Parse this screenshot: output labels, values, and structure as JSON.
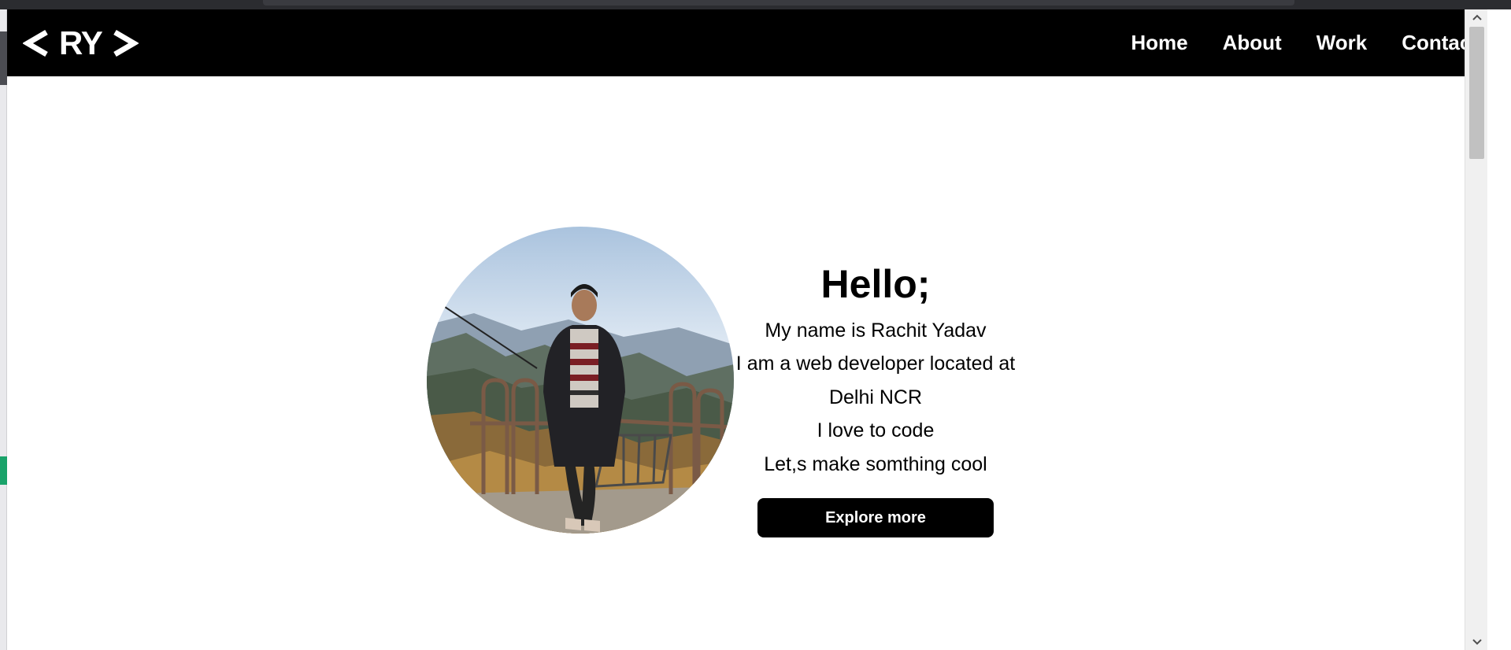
{
  "navbar": {
    "logo_text": "RY",
    "links": [
      {
        "label": "Home"
      },
      {
        "label": "About"
      },
      {
        "label": "Work"
      },
      {
        "label": "Contact"
      }
    ]
  },
  "hero": {
    "heading": "Hello;",
    "lines": [
      "My name is Rachit Yadav",
      "I am a web developer located at",
      "Delhi NCR",
      "I love to code",
      "Let,s make somthing cool"
    ],
    "button_label": "Explore more"
  },
  "colors": {
    "navbar_bg": "#000000",
    "text": "#000000",
    "button_bg": "#000000",
    "button_text": "#ffffff"
  },
  "icons": {
    "logo_left": "chevron-left-icon",
    "logo_right": "chevron-right-icon",
    "scroll_up": "scroll-up-arrow-icon",
    "scroll_down": "scroll-down-arrow-icon"
  }
}
